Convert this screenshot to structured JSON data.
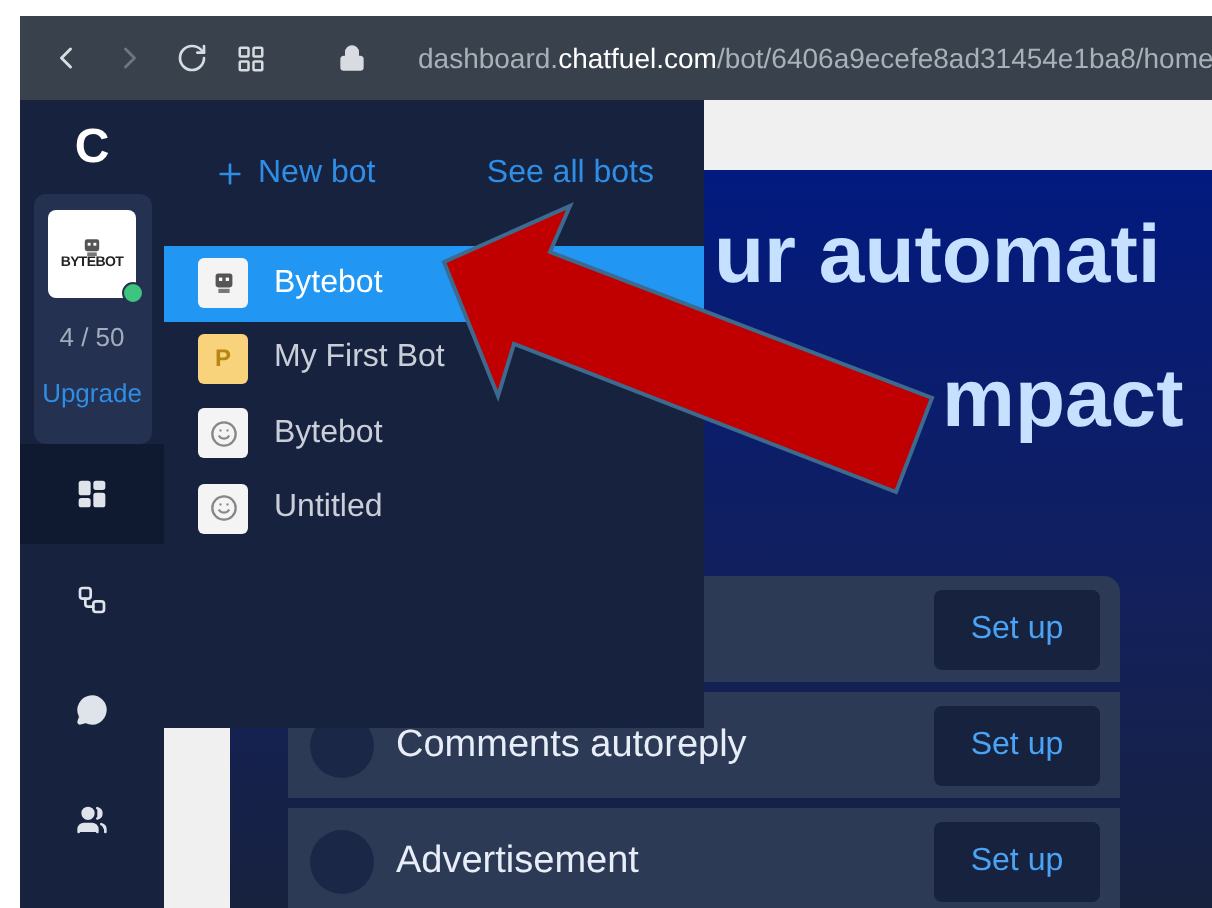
{
  "browser": {
    "address": {
      "parts": [
        {
          "text": "dashboard.",
          "emphasis": false
        },
        {
          "text": "chatfuel.com",
          "emphasis": true
        },
        {
          "text": "/bot/6406a9ecefe8ad31454e1ba8/home",
          "emphasis": false
        }
      ]
    }
  },
  "rail": {
    "logo": "C",
    "bot": {
      "label": "BYTEBOT",
      "online": true,
      "usage": "4 / 50",
      "upgrade": "Upgrade"
    },
    "nav": [
      {
        "kind": "dashboard",
        "selected": true
      },
      {
        "kind": "flows",
        "selected": false
      },
      {
        "kind": "chat",
        "selected": false
      },
      {
        "kind": "people",
        "selected": false
      }
    ]
  },
  "bot_menu": {
    "new_bot": "New bot",
    "see_all": "See all bots",
    "bots": [
      {
        "name": "Bytebot",
        "avatar": {
          "kind": "logo"
        },
        "selected": true
      },
      {
        "name": "My First Bot",
        "avatar": {
          "kind": "letter",
          "letter": "P"
        },
        "selected": false
      },
      {
        "name": "Bytebot",
        "avatar": {
          "kind": "smiley"
        },
        "selected": false
      },
      {
        "name": "Untitled",
        "avatar": {
          "kind": "smiley"
        },
        "selected": false
      }
    ]
  },
  "hero": {
    "lines": [
      "ur automati",
      "mpact"
    ]
  },
  "tasks": [
    {
      "action": "Set up"
    },
    {
      "title": "Comments autoreply",
      "action": "Set up"
    },
    {
      "title": "Advertisement",
      "action": "Set up"
    }
  ],
  "annotation": {
    "kind": "arrow"
  }
}
